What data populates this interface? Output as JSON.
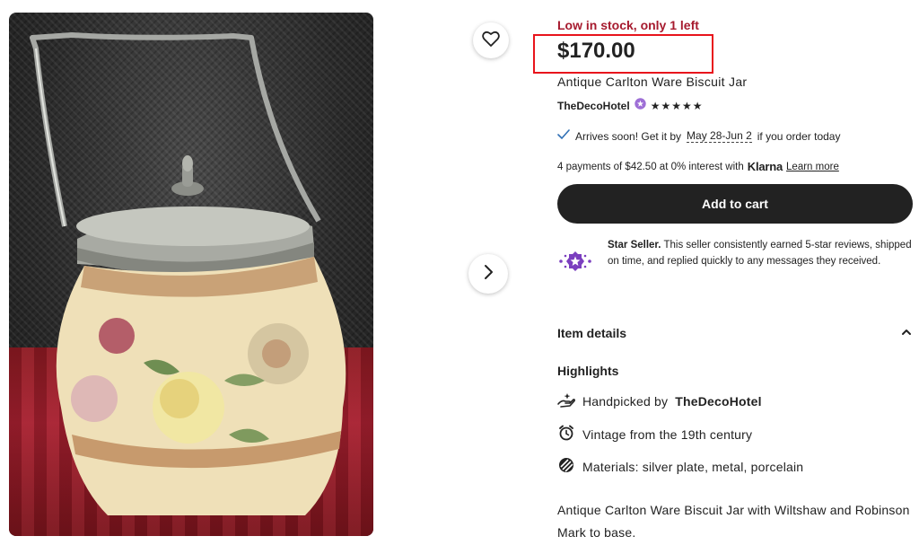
{
  "photo": {
    "icon": "biscuit-jar-photo"
  },
  "buttons": {
    "favorite_icon": "heart-icon",
    "next_icon": "chevron-right-icon"
  },
  "listing": {
    "stock_alert": "Low in stock, only 1 left",
    "price": "$170.00",
    "title": "Antique Carlton Ware Biscuit Jar",
    "shop_name": "TheDecoHotel",
    "rating_stars": "★★★★★",
    "rating_value": 5
  },
  "shipping": {
    "prefix": "Arrives soon! Get it by",
    "dates": "May 28-Jun 2",
    "suffix": "if you order today"
  },
  "payments": {
    "text": "4 payments of $42.50 at 0% interest with",
    "provider": "Klarna",
    "link": "Learn more"
  },
  "cart": {
    "label": "Add to cart"
  },
  "star_seller": {
    "title": "Star Seller.",
    "text": "This seller consistently earned 5-star reviews, shipped on time, and replied quickly to any messages they received."
  },
  "details": {
    "heading": "Item details",
    "highlights_heading": "Highlights",
    "highlights": [
      {
        "icon": "hand-icon",
        "prefix": "Handpicked by",
        "bold": "TheDecoHotel"
      },
      {
        "icon": "alarm-clock-icon",
        "text": "Vintage from the 19th century"
      },
      {
        "icon": "materials-icon",
        "text": "Materials: silver plate, metal, porcelain"
      }
    ],
    "description": "Antique Carlton Ware Biscuit Jar with Wiltshaw and Robinson Mark to base."
  },
  "colors": {
    "stock": "#a61a2e",
    "highlight_box": "#e8141c",
    "button": "#222222",
    "star_seller": "#7b3fbf"
  }
}
